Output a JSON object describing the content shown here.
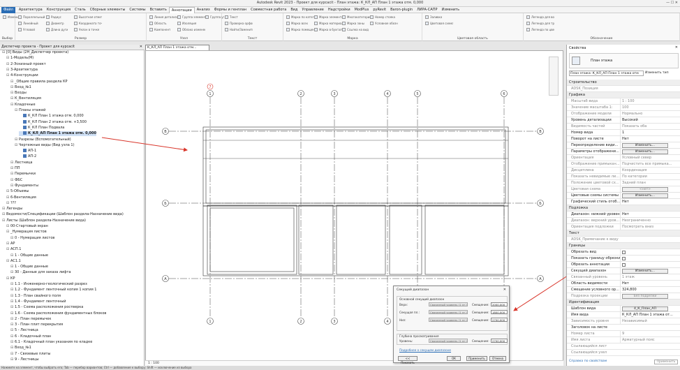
{
  "titlebar": {
    "title": "Autodesk Revit 2023 - Проект для курсаcit - План этажа: К_КЛ_АП План 1 этажа отм. 0,000"
  },
  "menu": {
    "file": "Файл",
    "tabs": [
      "Архитектура",
      "Конструкция",
      "Сталь",
      "Сборные элементы",
      "Системы",
      "Вставить",
      "Аннотации",
      "Анализ",
      "Формы и генплан",
      "Совместная работа",
      "Вид",
      "Управление",
      "Надстройки",
      "ModPlus",
      "pyRevit",
      "Baron-plugin",
      "ЛИРА-САПР",
      "Изменить"
    ]
  },
  "ribbon": {
    "groups": [
      {
        "label": "Выбор",
        "items": [
          "Изменить"
        ]
      },
      {
        "label": "Размер",
        "items": [
          "Параллельный",
          "Линейный",
          "Угловой",
          "Радиус",
          "Диаметр",
          "Длина дуги",
          "Высотная отметка",
          "Координата точки",
          "Уклон в точке"
        ]
      },
      {
        "label": "Узел",
        "items": [
          "Линия детализации",
          "Область",
          "Компонент",
          "Группа элементов узла",
          "Изоляция",
          "Облако изменений",
          "Группа узлов"
        ]
      },
      {
        "label": "Текст",
        "items": [
          "Текст",
          "Проверка орфографии",
          "Найти/Заменить"
        ]
      },
      {
        "label": "Марка",
        "items": [
          "Марка по категории",
          "Марка всех",
          "Марка помещения",
          "Марка элемента узла",
          "Марка материала",
          "Марка в бухгалтерии",
          "Многокатегорийная",
          "Марка зоны",
          "Ссылка на вид",
          "Номер стояка",
          "Условное обозначение"
        ]
      },
      {
        "label": "Цветовая область",
        "items": [
          "Заливка",
          "Цветовая схема"
        ]
      },
      {
        "label": "Обозначение",
        "items": [
          "Легенда для воздуховодов",
          "Легенда для труб",
          "Легенда по цвету"
        ]
      }
    ]
  },
  "project_browser": {
    "title": "Диспетчер проекта - Проект для курсаcit",
    "items": [
      "[0] Виды (2Н_Диспетчер проекта)",
      "1-Модель(М)",
      "2-Эскизный проект",
      "3-Архитектура",
      "4-Конструкции",
      "_Общие правила раздела КР",
      "Вход_№1",
      "Входы",
      "К_Вентиляция",
      "Кладочные",
      "Планы этажей",
      "К_КЛ План 1 этажа отм. 0,000",
      "К_КЛ План 2 этажа отм. +3,500",
      "К_КЛ План Подвала",
      "К_КЛ_АП План 1 этажа отм. 0,000",
      "Разрезы (Вспомогательный)",
      "Чертежные виды (Вид узла 1)",
      "АП-1",
      "АП-2",
      "Лестница",
      "ПП",
      "Перемычки",
      "ФБС",
      "Фундаменты",
      "5-Объемы",
      "6-Вентиляция",
      "???",
      "Легенды",
      "Ведомости/Спецификации (Шаблон раздела-Назначение вида)",
      "Листы (Шаблон раздела-Назначение вида)",
      "00-Стартовый экран",
      "_Нумерация листов",
      "0 - Нумерация листов",
      "АР",
      "АСП.1",
      "1 - Общие данные",
      "АС1.1",
      "1 - Общие данные",
      "30 - Данные для заказа лифта",
      "КР",
      "1.1 - Инженерно-геологический разрез",
      "1.2 - Фундамент ленточный копия 1 копия 1",
      "1.3 - План свайного поля",
      "1.4 - Фундамент ленточный",
      "1.5 - Схема расположения ростверка",
      "1.6 - Схема расположения фундаментных блоков",
      "2 - План перемычек",
      "3 - План плит перекрытия",
      "5 - Лестница",
      "6 - Кладочный план",
      "6.1 - Кладочный план указания по кладке",
      "Вход_№1",
      "7 - Связевые плиты",
      "9 - Лестницы"
    ]
  },
  "doc_tab": {
    "label": "К_КЛ_АП План 1 этажа отм..."
  },
  "drawing": {
    "grid_top": [
      "1",
      "2",
      "3",
      "4",
      "5",
      "6"
    ],
    "grid_side": [
      "В",
      "Б",
      "А"
    ],
    "top_extra": "7"
  },
  "status": {
    "scale": "1 : 100",
    "bottom": "Нажмите на элемент, чтобы выбрать его; Tab — перебор вариантов; Ctrl — добавление к выбору; Shift — исключение из выбора"
  },
  "properties": {
    "title": "Свойства",
    "type_name": "План этажа",
    "selector": "План этажа: К_КЛ_АП План 1 этажа отм",
    "edit_type": "Изменить тип",
    "link": "Справка по свойствам",
    "apply": "Применить",
    "rows": [
      {
        "kind": "sec",
        "k": "Строительство"
      },
      {
        "k": "ADSK_Позиция",
        "v": "",
        "grey": true
      },
      {
        "kind": "sec",
        "k": "Графика"
      },
      {
        "k": "Масштаб вида",
        "v": "1 : 100",
        "grey": true
      },
      {
        "k": "Значение масштаба  1:",
        "v": "100",
        "grey": true
      },
      {
        "k": "Отображение модели",
        "v": "Нормально",
        "grey": true
      },
      {
        "k": "Уровень детализации",
        "v": "Высокий"
      },
      {
        "k": "Видимость частей",
        "v": "Показать оба",
        "grey": true
      },
      {
        "k": "Номер вида",
        "v": "1"
      },
      {
        "k": "Поворот на листе",
        "v": "Нет"
      },
      {
        "k": "Переопределение види...",
        "v": "Изменить...",
        "btn": true
      },
      {
        "k": "Параметры отображени...",
        "v": "Изменить...",
        "btn": true
      },
      {
        "k": "Ориентация",
        "v": "Условный север",
        "grey": true
      },
      {
        "k": "Отображение примыкан...",
        "v": "Подчистить все примыка...",
        "grey": true
      },
      {
        "k": "Дисциплина",
        "v": "Координация",
        "grey": true
      },
      {
        "k": "Показать невидимые ли...",
        "v": "По категории",
        "grey": true
      },
      {
        "k": "Положение цветовой сх...",
        "v": "Задний план",
        "grey": true
      },
      {
        "k": "Цветовая схема",
        "v": "<нет>",
        "btn": true,
        "grey": true
      },
      {
        "k": "Цветовые схемы системы",
        "v": "Изменить...",
        "btn": true
      },
      {
        "k": "Графический стиль отоб...",
        "v": "Нет"
      },
      {
        "kind": "sec",
        "k": "Подложка"
      },
      {
        "k": "Диапазон: нижний уровен...",
        "v": "Нет"
      },
      {
        "k": "Диапазон: верхний уров...",
        "v": "Неограниченно",
        "grey": true
      },
      {
        "k": "Ориентация подложки",
        "v": "Посмотреть вниз",
        "grey": true
      },
      {
        "kind": "sec",
        "k": "Текст"
      },
      {
        "k": "ADSK_Примечание к виду",
        "v": "",
        "grey": true
      },
      {
        "kind": "sec",
        "k": "Границы"
      },
      {
        "k": "Обрезать вид",
        "v": "",
        "chk": true
      },
      {
        "k": "Показать границу обрезки",
        "v": "",
        "chk": true
      },
      {
        "k": "Обрезать аннотации",
        "v": "",
        "chk": true
      },
      {
        "k": "Секущий диапазон",
        "v": "Изменить...",
        "btn": true
      },
      {
        "k": "Связанный уровень",
        "v": "1 этаж",
        "grey": true
      },
      {
        "k": "Область видимости",
        "v": "Нет"
      },
      {
        "k": "Смещение условного ор...",
        "v": "324,800"
      },
      {
        "k": "Подрезка проекции",
        "v": "Без подрезки",
        "btn": true,
        "grey": true
      },
      {
        "kind": "sec",
        "k": "Идентификация"
      },
      {
        "k": "Шаблон вида",
        "v": "4_К_План_АП",
        "btn": true
      },
      {
        "k": "Имя вида",
        "v": "К_КЛ_АП План 1 этажа от..."
      },
      {
        "k": "Зависимость уровня",
        "v": "Независимый",
        "grey": true
      },
      {
        "k": "Заголовок на листе",
        "v": ""
      },
      {
        "k": "Номер листа",
        "v": "9",
        "grey": true
      },
      {
        "k": "Имя листа",
        "v": "Арматурный пояс",
        "grey": true
      },
      {
        "k": "Ссылающийся лист",
        "v": "",
        "grey": true
      },
      {
        "k": "Ссылающийся узел",
        "v": "",
        "grey": true
      }
    ]
  },
  "dialog": {
    "title": "Секущий диапазон",
    "group_main": "Основной секущий диапазон",
    "group_depth": "Глубина просматривания",
    "rows": [
      {
        "label": "Верх:",
        "level": "Связанный уровень (1 эт.)",
        "off_label": "Смещение:",
        "off": "2000,000"
      },
      {
        "label": "Секущая пл.:",
        "level": "Связанный уровень (1 эт.)",
        "off_label": "Смещение:",
        "off": "1800,000"
      },
      {
        "label": "Низ:",
        "level": "Связанный уровень (1 эт.)",
        "off_label": "Смещение:",
        "off": "2700,000"
      },
      {
        "label": "Уровень:",
        "level": "Связанный уровень (1 эт.)",
        "off_label": "Смещение:",
        "off": "2700,000"
      }
    ],
    "help_link": "Подробнее о секущем диапазоне",
    "btn_show": "<< Показать",
    "btn_ok": "ОК",
    "btn_apply": "Применить",
    "btn_cancel": "Отмена",
    "close": "✕"
  },
  "colors": {
    "arrow": "#d9362b",
    "accent": "#2a6db5",
    "section": "#efefef"
  }
}
